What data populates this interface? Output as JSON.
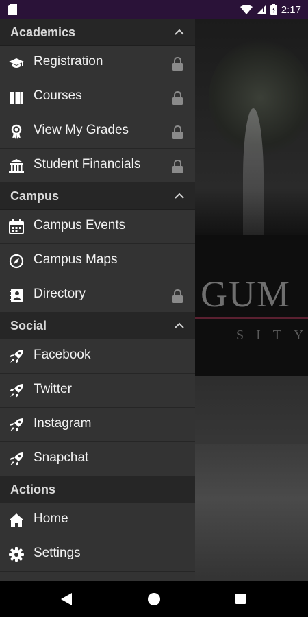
{
  "status_bar": {
    "time": "2:17",
    "icons": [
      "sim-card-icon",
      "wifi-icon",
      "signal-icon",
      "battery-icon"
    ]
  },
  "drawer": {
    "sections": [
      {
        "title": "Academics",
        "collapsible": true,
        "items": [
          {
            "label": "Registration",
            "icon": "graduation-cap-icon",
            "locked": true
          },
          {
            "label": "Courses",
            "icon": "book-icon",
            "locked": true
          },
          {
            "label": "View My Grades",
            "icon": "award-icon",
            "locked": true
          },
          {
            "label": "Student Financials",
            "icon": "bank-icon",
            "locked": true
          }
        ]
      },
      {
        "title": "Campus",
        "collapsible": true,
        "items": [
          {
            "label": "Campus Events",
            "icon": "calendar-icon",
            "locked": false
          },
          {
            "label": "Campus Maps",
            "icon": "compass-icon",
            "locked": false
          },
          {
            "label": "Directory",
            "icon": "address-book-icon",
            "locked": true
          }
        ]
      },
      {
        "title": "Social",
        "collapsible": true,
        "items": [
          {
            "label": "Facebook",
            "icon": "rocket-icon",
            "locked": false
          },
          {
            "label": "Twitter",
            "icon": "rocket-icon",
            "locked": false
          },
          {
            "label": "Instagram",
            "icon": "rocket-icon",
            "locked": false
          },
          {
            "label": "Snapchat",
            "icon": "rocket-icon",
            "locked": false
          }
        ]
      },
      {
        "title": "Actions",
        "collapsible": false,
        "items": [
          {
            "label": "Home",
            "icon": "home-icon",
            "locked": false
          },
          {
            "label": "Settings",
            "icon": "gear-icon",
            "locked": false
          }
        ]
      }
    ]
  },
  "background": {
    "logo_text": "GUM",
    "logo_subtext": "SITY"
  },
  "nav_bar": {
    "icons": [
      "back-icon",
      "home-circle-icon",
      "recents-icon"
    ]
  },
  "colors": {
    "status_bar": "#2a1238",
    "drawer_bg": "#333333",
    "section_header_bg": "#262626",
    "text": "#f2f2f2",
    "muted": "#8a8a8a"
  }
}
